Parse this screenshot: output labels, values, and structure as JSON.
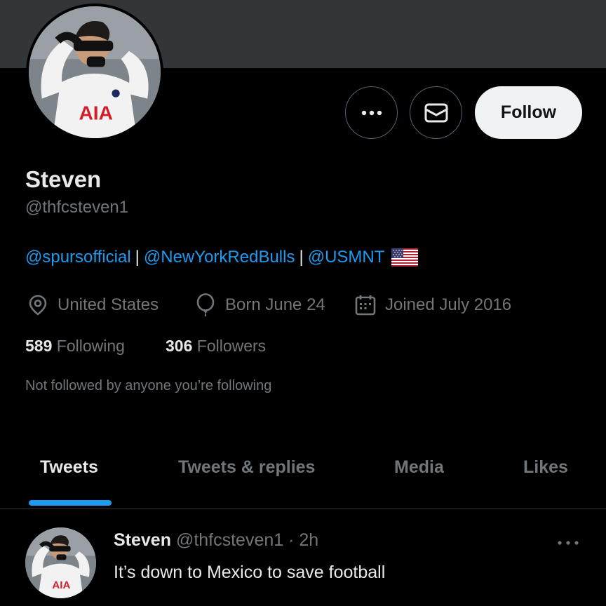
{
  "profile": {
    "name": "Steven",
    "handle": "@thfcsteven1",
    "follow_label": "Follow",
    "avatar_icon": "profile-photo",
    "bio": {
      "link1": "@spursofficial",
      "sep1": "|",
      "link2": "@NewYorkRedBulls",
      "sep2": "|",
      "link3": "@USMNT",
      "flag_icon": "us-flag-icon"
    },
    "location": "United States",
    "birthday": "Born June 24",
    "joined": "Joined July 2016",
    "following_count": "589",
    "following_label": "Following",
    "followers_count": "306",
    "followers_label": "Followers",
    "not_followed_text": "Not followed by anyone you’re following"
  },
  "tabs": [
    {
      "label": "Tweets",
      "active": true
    },
    {
      "label": "Tweets & replies",
      "active": false
    },
    {
      "label": "Media",
      "active": false
    },
    {
      "label": "Likes",
      "active": false
    }
  ],
  "tweet": {
    "name": "Steven",
    "meta": "@thfcsteven1 · 2h",
    "text": "It’s down to Mexico to save football"
  },
  "colors": {
    "background": "#000000",
    "banner": "#333639",
    "accent": "#1d9bf0",
    "muted_text": "#71767b",
    "primary_text": "#e7e9ea",
    "follow_button_bg": "#eff3f4"
  }
}
